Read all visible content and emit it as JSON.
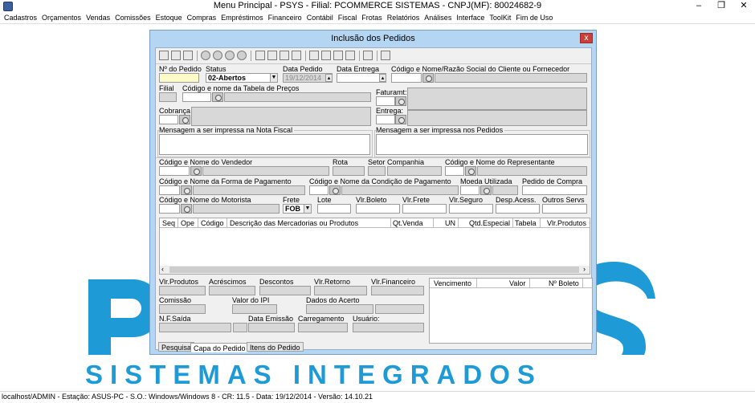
{
  "window": {
    "title": "Menu Principal - PSYS - Filial: PCOMMERCE SISTEMAS - CNPJ(MF): 80024682-9",
    "controls": {
      "minimize": "–",
      "restore": "❐",
      "close": "✕"
    }
  },
  "menubar": {
    "items": [
      "Cadastros",
      "Orçamentos",
      "Vendas",
      "Comissões",
      "Estoque",
      "Compras",
      "Empréstimos",
      "Financeiro",
      "Contábil",
      "Fiscal",
      "Frotas",
      "Relatórios",
      "Análises",
      "Interface",
      "ToolKit",
      "Fim de Uso"
    ]
  },
  "background_logo": {
    "letters": "PSYS",
    "subtitle": "SISTEMAS INTEGRADOS",
    "color": "#1e9bd6"
  },
  "statusbar": {
    "text": "localhost/ADMIN - Estação: ASUS-PC - S.O.: Windows/Windows 8 - CR: 11.5  - Data: 19/12/2014 - Versão: 14.10.21"
  },
  "dialog": {
    "title": "Inclusão dos Pedidos",
    "close_label": "x",
    "header": {
      "labels": {
        "pedido_num": "Nº do Pedido",
        "status": "Status",
        "data_pedido": "Data Pedido",
        "data_entrega": "Data Entrega",
        "cliente": "Código e Nome/Razão Social do Cliente ou Fornecedor",
        "filial": "Filial",
        "tabela_precos": "Código e nome da Tabela de Preços",
        "faturamento": "Faturamt:",
        "cobranca": "Cobrança",
        "entrega": "Entrega:",
        "msg_nf": "Mensagem a ser impressa na Nota Fiscal",
        "msg_pedidos": "Mensagem a ser impressa nos Pedidos"
      },
      "values": {
        "status": "02-Abertos",
        "data_pedido": "19/12/2014"
      }
    },
    "people": {
      "labels": {
        "vendedor": "Código e Nome do Vendedor",
        "rota": "Rota",
        "setor": "Setor Companhia",
        "representante": "Código e Nome do Representante",
        "forma_pagamento": "Código e Nome da Forma de Pagamento",
        "condicao_pagamento": "Código e Nome da Condição de Pagamento",
        "moeda": "Moeda Utilizada",
        "pedido_compra": "Pedido de Compra",
        "motorista": "Código e Nome do Motorista",
        "frete": "Frete",
        "lote": "Lote",
        "vlr_boleto": "Vlr.Boleto",
        "vlr_frete": "Vlr.Frete",
        "vlr_seguro": "Vlr.Seguro",
        "desp_acess": "Desp.Acess.",
        "outros_servs": "Outros Servs"
      },
      "values": {
        "frete": "FOB"
      }
    },
    "grid": {
      "columns": [
        "Seq",
        "Ope",
        "Código",
        "Descrição das Mercadorias ou Produtos",
        "Qt.Venda",
        "UN",
        "Qtd.Especial",
        "Tabela",
        "Vlr.Produtos"
      ]
    },
    "totals": {
      "labels": {
        "vlr_produtos": "Vlr.Produtos",
        "acrescimos": "Acréscimos",
        "descontos": "Descontos",
        "vlr_retorno": "Vlr.Retorno",
        "vlr_financeiro": "Vlr.Financeiro",
        "comissao": "Comissão",
        "valor_ipi": "Valor do IPI",
        "dados_acerto": "Dados do Acerto",
        "nf_saida": "N.F.Saída",
        "data_emissao": "Data Emissão",
        "carregamento": "Carregamento",
        "usuario": "Usuário:"
      }
    },
    "vencimentos": {
      "columns": [
        "Vencimento",
        "Valor",
        "Nº Boleto"
      ]
    },
    "tabs": [
      "Pesquisa",
      "Capa do Pedido",
      "Itens do Pedido"
    ]
  }
}
